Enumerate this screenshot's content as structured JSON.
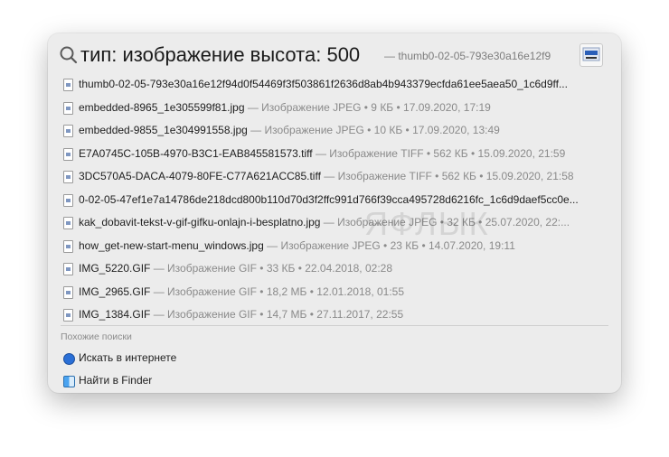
{
  "search": {
    "query": "тип: изображение высота: 500",
    "hint": "— thumb0-02-05-793e30a16e12f9"
  },
  "results": [
    {
      "name": "thumb0-02-05-793e30a16e12f94d0f54469f3f503861f2636d8ab4b943379ecfda61ee5aea50_1c6d9ff...",
      "meta": ""
    },
    {
      "name": "embedded-8965_1e305599f81.jpg",
      "meta": " — Изображение JPEG • 9 КБ • 17.09.2020, 17:19"
    },
    {
      "name": "embedded-9855_1e304991558.jpg",
      "meta": " — Изображение JPEG • 10 КБ • 17.09.2020, 13:49"
    },
    {
      "name": "E7A0745C-105B-4970-B3C1-EAB845581573.tiff",
      "meta": " — Изображение TIFF • 562 КБ • 15.09.2020, 21:59"
    },
    {
      "name": "3DC570A5-DACA-4079-80FE-C77A621ACC85.tiff",
      "meta": " — Изображение TIFF • 562 КБ • 15.09.2020, 21:58"
    },
    {
      "name": "0-02-05-47ef1e7a14786de218dcd800b110d70d3f2ffc991d766f39cca495728d6216fc_1c6d9daef5cc0e...",
      "meta": ""
    },
    {
      "name": "kak_dobavit-tekst-v-gif-gifku-onlajn-i-besplatno.jpg",
      "meta": " — Изображение JPEG • 32 КБ • 25.07.2020, 22:..."
    },
    {
      "name": "how_get-new-start-menu_windows.jpg",
      "meta": " — Изображение JPEG • 23 КБ • 14.07.2020, 19:11"
    },
    {
      "name": "IMG_5220.GIF",
      "meta": " — Изображение GIF • 33 КБ • 22.04.2018, 02:28"
    },
    {
      "name": "IMG_2965.GIF",
      "meta": " — Изображение GIF • 18,2 МБ • 12.01.2018, 01:55"
    },
    {
      "name": "IMG_1384.GIF",
      "meta": " — Изображение GIF • 14,7 МБ • 27.11.2017, 22:55"
    }
  ],
  "similar": {
    "label": "Похожие поиски",
    "search_web": "Искать в интернете",
    "find_in_finder": "Найти в Finder"
  },
  "watermark": "ЯФЛЫК"
}
